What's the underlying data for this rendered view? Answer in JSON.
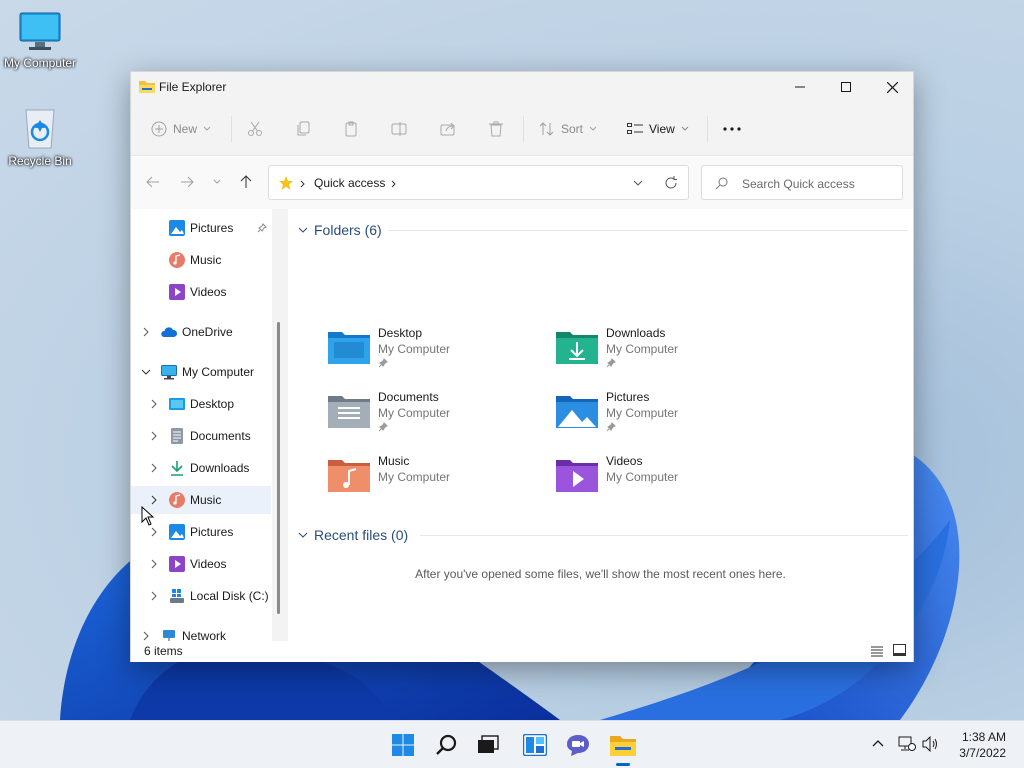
{
  "desktop": {
    "icons": [
      {
        "label": "My Computer",
        "icon": "monitor-icon"
      },
      {
        "label": "Recycle Bin",
        "icon": "recycle-bin-icon"
      }
    ]
  },
  "window": {
    "title": "File Explorer",
    "controls": [
      "minimize-icon",
      "maximize-icon",
      "close-icon"
    ]
  },
  "commandbar": {
    "new_label": "New",
    "sort_label": "Sort",
    "view_label": "View",
    "buttons": [
      "cut-icon",
      "copy-icon",
      "paste-icon",
      "rename-icon",
      "share-icon",
      "delete-icon"
    ],
    "more": "..."
  },
  "navigation": {
    "breadcrumb": "Quick access",
    "search_placeholder": "Search Quick access"
  },
  "sidebar": {
    "items": [
      {
        "label": "Pictures",
        "icon": "pictures-icon",
        "pinned": true
      },
      {
        "label": "Music",
        "icon": "music-icon"
      },
      {
        "label": "Videos",
        "icon": "videos-icon"
      },
      {
        "label": "OneDrive",
        "icon": "onedrive-icon"
      },
      {
        "label": "My Computer",
        "icon": "computer-icon",
        "expanded": true
      },
      {
        "label": "Desktop",
        "icon": "desktop-icon"
      },
      {
        "label": "Documents",
        "icon": "documents-icon"
      },
      {
        "label": "Downloads",
        "icon": "downloads-icon"
      },
      {
        "label": "Music",
        "icon": "music-icon",
        "hovered": true
      },
      {
        "label": "Pictures",
        "icon": "pictures-icon"
      },
      {
        "label": "Videos",
        "icon": "videos-icon"
      },
      {
        "label": "Local Disk (C:)",
        "icon": "drive-icon"
      },
      {
        "label": "Network",
        "icon": "network-icon"
      }
    ]
  },
  "content": {
    "folders_header": "Folders (6)",
    "folders": [
      {
        "name": "Desktop",
        "location": "My Computer",
        "pinned": true
      },
      {
        "name": "Downloads",
        "location": "My Computer",
        "pinned": true
      },
      {
        "name": "Documents",
        "location": "My Computer",
        "pinned": true
      },
      {
        "name": "Pictures",
        "location": "My Computer",
        "pinned": true
      },
      {
        "name": "Music",
        "location": "My Computer",
        "pinned": false
      },
      {
        "name": "Videos",
        "location": "My Computer",
        "pinned": false
      }
    ],
    "recent_header": "Recent files (0)",
    "recent_empty": "After you've opened some files, we'll show the most recent ones here."
  },
  "statusbar": {
    "count": "6 items"
  },
  "taskbar": {
    "items": [
      "start-icon",
      "search-icon",
      "task-view-icon",
      "widgets-icon",
      "chat-icon",
      "file-explorer-icon"
    ],
    "time": "1:38 AM",
    "date": "3/7/2022"
  },
  "colors": {
    "accent": "#0067c0",
    "header_text": "#2b4c7e",
    "hover": "#eaf1fb"
  }
}
